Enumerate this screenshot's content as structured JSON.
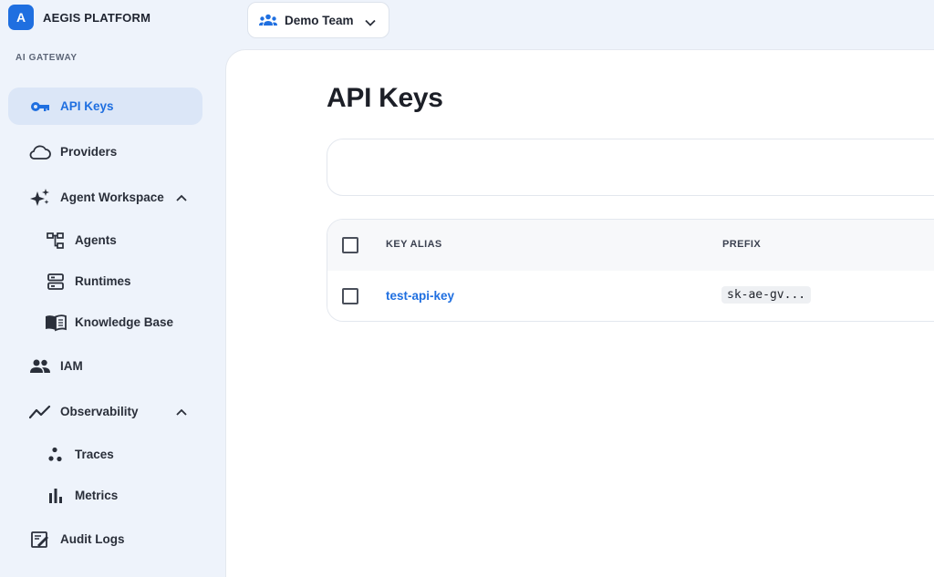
{
  "brand": {
    "badge": "A",
    "name": "AEGIS PLATFORM"
  },
  "sidebar": {
    "section_label": "AI GATEWAY",
    "items": [
      {
        "label": "API Keys",
        "icon": "key-icon",
        "active": true
      },
      {
        "label": "Providers",
        "icon": "cloud-icon"
      },
      {
        "label": "Agent Workspace",
        "icon": "sparkles-icon",
        "expanded": true
      },
      {
        "label": "Agents",
        "icon": "hierarchy-icon"
      },
      {
        "label": "Runtimes",
        "icon": "server-icon"
      },
      {
        "label": "Knowledge Base",
        "icon": "book-icon"
      },
      {
        "label": "IAM",
        "icon": "people-icon"
      },
      {
        "label": "Observability",
        "icon": "trend-line-icon",
        "expanded": true
      },
      {
        "label": "Traces",
        "icon": "dots-icon"
      },
      {
        "label": "Metrics",
        "icon": "bar-chart-icon"
      },
      {
        "label": "Audit Logs",
        "icon": "audit-log-icon"
      }
    ]
  },
  "topbar": {
    "team_name": "Demo Team"
  },
  "main": {
    "title": "API Keys",
    "table": {
      "columns": [
        "KEY ALIAS",
        "PREFIX"
      ],
      "rows": [
        {
          "alias": "test-api-key",
          "prefix": "sk-ae-gv..."
        }
      ]
    }
  },
  "colors": {
    "accent": "#1f6fe0",
    "sidebar_bg": "#eef3fb",
    "active_bg": "#dbe6f7"
  }
}
